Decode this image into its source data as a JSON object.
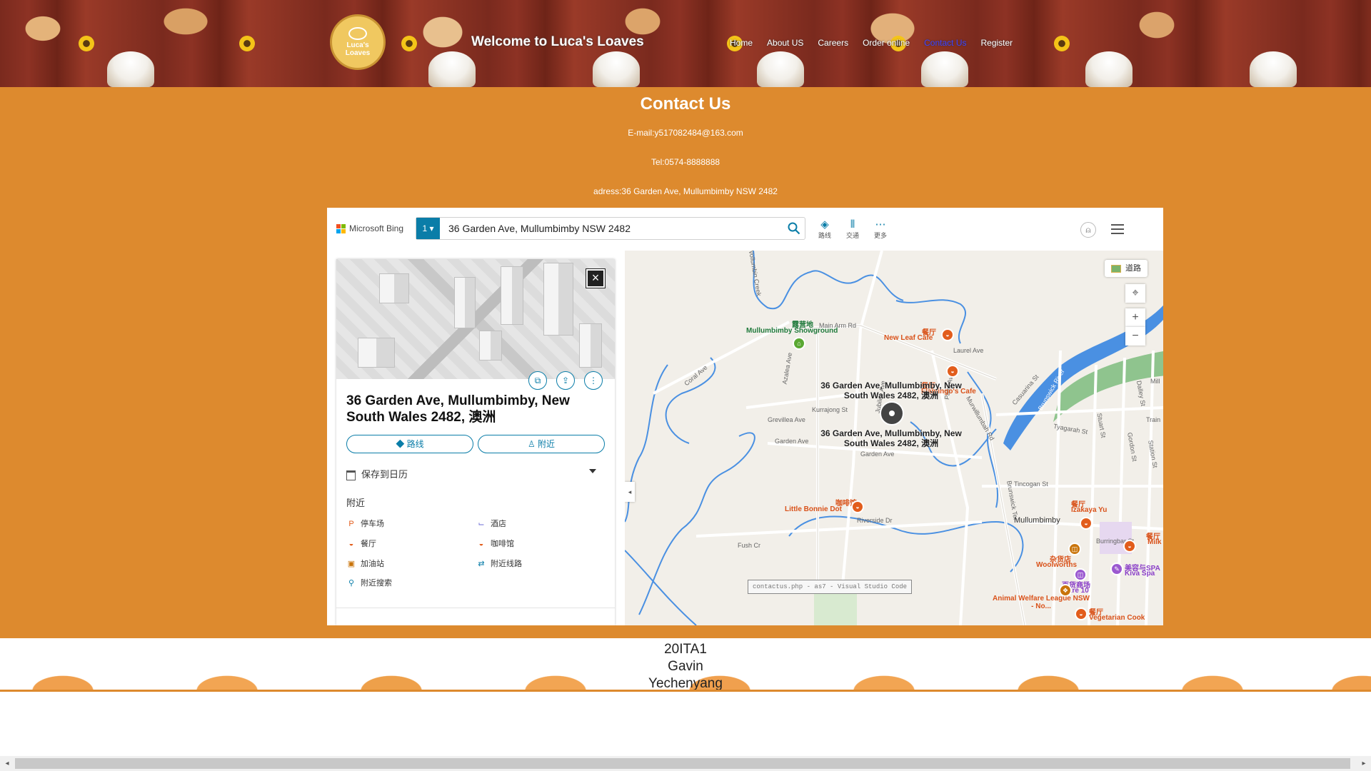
{
  "header": {
    "logo_text_1": "Luca's",
    "logo_text_2": "Loaves",
    "title": "Welcome to Luca's Loaves",
    "nav": [
      {
        "label": "Home"
      },
      {
        "label": "About US"
      },
      {
        "label": "Careers"
      },
      {
        "label": "Order online"
      },
      {
        "label": "Contact Us",
        "active": true
      },
      {
        "label": "Register"
      }
    ]
  },
  "contact": {
    "title": "Contact Us",
    "email": "E-mail:y517082484@163.com",
    "tel": "Tel:0574-8888888",
    "address": "adress:36 Garden Ave, Mullumbimby NSW 2482"
  },
  "map": {
    "brand": "Microsoft Bing",
    "scope_label": "1",
    "search_value": "36 Garden Ave, Mullumbimby NSW 2482",
    "tools": [
      {
        "icon": "directions-icon",
        "label": "路线"
      },
      {
        "icon": "traffic-icon",
        "label": "交通"
      },
      {
        "icon": "more-icon",
        "label": "更多"
      }
    ],
    "panel": {
      "address": "36 Garden Ave, Mullumbimby, New South Wales 2482, 澳洲",
      "directions_btn": "路线",
      "nearby_btn": "附近",
      "calendar": "保存到日历",
      "nearby_title": "附近",
      "nearby_items": [
        {
          "icon": "parking-icon",
          "label": "停车场"
        },
        {
          "icon": "hotel-icon",
          "label": "酒店"
        },
        {
          "icon": "restaurant-icon",
          "label": "餐厅"
        },
        {
          "icon": "coffee-icon",
          "label": "咖啡馆"
        },
        {
          "icon": "gas-station-icon",
          "label": "加油站"
        },
        {
          "icon": "transit-icon",
          "label": "附近线路"
        },
        {
          "icon": "search-icon",
          "label": "附近搜索"
        }
      ]
    },
    "road_button": "道路",
    "pin_label": "36 Garden Ave, Mullumbimby, New South Wales 2482, 澳洲",
    "labels": {
      "campground_cat": "露营地",
      "campground": "Mullumbimby Showground",
      "restaurant_cat": "餐厅",
      "new_leaf": "New Leaf Cafe",
      "flamingo": "Flamingo's Cafe",
      "cafe_cat": "咖啡馆",
      "bonnie": "Little Bonnie Dot",
      "izakaya": "Izakaya Yu",
      "milk": "Milk",
      "grocery_cat": "杂货店",
      "woolworths": "Woolworths",
      "spa_cat": "美容与SPA",
      "kiva": "Kiva Spa",
      "dept_cat": "百货商场",
      "mitre": "Mitre 10",
      "animal": "Animal Welfare League NSW - No...",
      "vegetarian": "Vegetarian Cook",
      "town": "Mullumbimby"
    },
    "streets": [
      "Main Arm Rd",
      "Laurel Ave",
      "Coral Ave",
      "Kurrajong St",
      "Grevillea Ave",
      "Garden Ave",
      "Riverside Dr",
      "Fush Cr",
      "Tincogan St",
      "Tyagarah St",
      "Burringbar St",
      "Stuart St",
      "Dalley St",
      "Gordon St",
      "Station St",
      "Brunswick Ter",
      "Murwillumbah Rd",
      "Casuarina St",
      "Palm Ave",
      "Jubilee Ave",
      "Azalea Ave",
      "Brunswick River",
      "Train",
      "Mill",
      "Wollumbin Creek"
    ],
    "tooltip": "contactus.php - as7 - Visual Studio Code"
  },
  "footer": {
    "line1": "20ITA1",
    "line2": "Gavin",
    "line3": "Yechenyang"
  },
  "colors": {
    "page_orange": "#dd8a2e",
    "nav_active": "#4040ff",
    "bing_teal": "#0a7da8",
    "poi_orange": "#e25d1c",
    "campground_green": "#5aa832",
    "spa_purple": "#9b59d0",
    "river_blue": "#4a90e2"
  }
}
